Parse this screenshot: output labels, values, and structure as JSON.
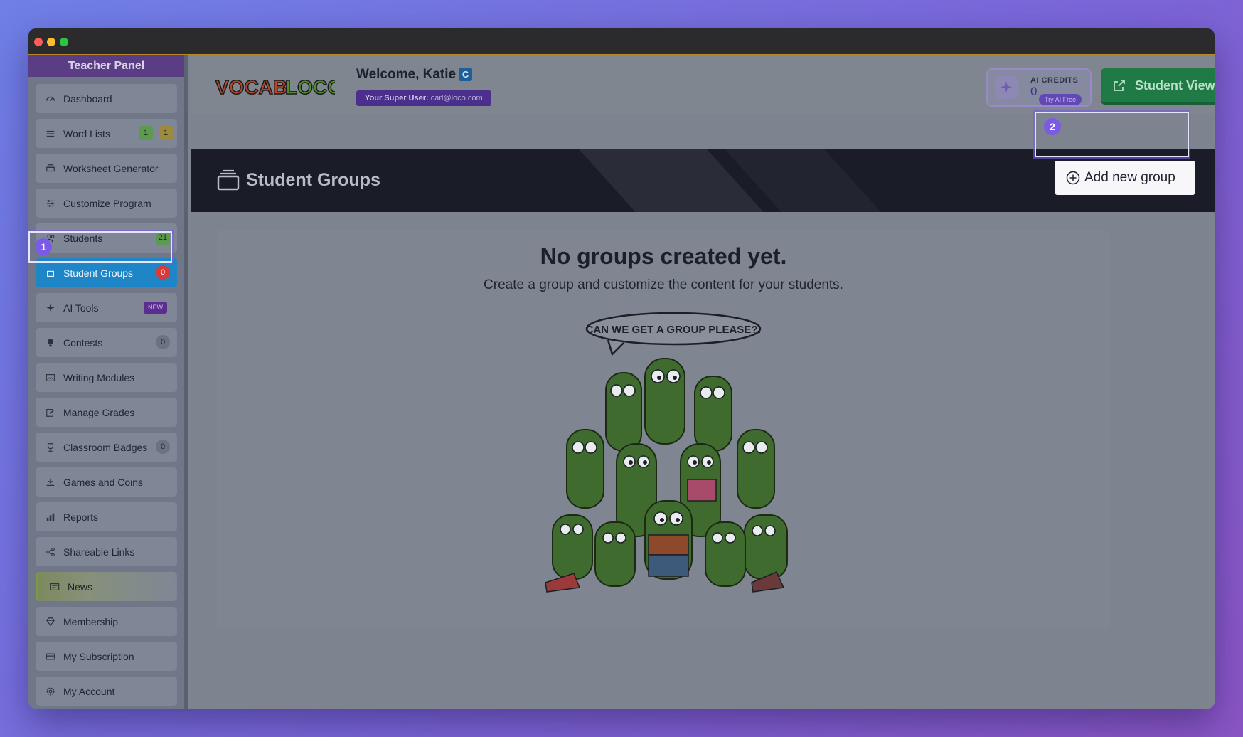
{
  "sidebar": {
    "title": "Teacher Panel",
    "items": [
      {
        "label": "Dashboard",
        "icon": "dashboard-icon"
      },
      {
        "label": "Word Lists",
        "icon": "list-icon",
        "badges": [
          "1",
          "1"
        ]
      },
      {
        "label": "Worksheet Generator",
        "icon": "printer-icon"
      },
      {
        "label": "Customize Program",
        "icon": "sliders-icon"
      },
      {
        "label": "Students",
        "icon": "users-icon",
        "badges": [
          "21"
        ]
      },
      {
        "label": "Student Groups",
        "icon": "layers-icon",
        "badges": [
          "0"
        ],
        "active": true
      },
      {
        "label": "AI Tools",
        "icon": "sparkle-icon",
        "badges": [
          "NEW"
        ]
      },
      {
        "label": "Contests",
        "icon": "lightbulb-icon",
        "badges": [
          "0"
        ]
      },
      {
        "label": "Writing Modules",
        "icon": "image-icon"
      },
      {
        "label": "Manage Grades",
        "icon": "edit-icon"
      },
      {
        "label": "Classroom Badges",
        "icon": "trophy-icon",
        "badges": [
          "0"
        ]
      },
      {
        "label": "Games and Coins",
        "icon": "coins-icon"
      },
      {
        "label": "Reports",
        "icon": "bar-chart-icon"
      },
      {
        "label": "Shareable Links",
        "icon": "share-icon"
      },
      {
        "label": "News",
        "icon": "newspaper-icon"
      },
      {
        "label": "Membership",
        "icon": "diamond-icon"
      },
      {
        "label": "My Subscription",
        "icon": "credit-card-icon"
      },
      {
        "label": "My Account",
        "icon": "gear-icon"
      }
    ]
  },
  "header": {
    "logo_text": "VOCAB LOCO",
    "welcome": "Welcome, Katie",
    "welcome_badge": "C",
    "super_user_label": "Your Super User:",
    "super_user_email": "carl@loco.com",
    "ai_credits_label": "AI CREDITS",
    "ai_credits_value": "0",
    "try_ai_free": "Try AI Free",
    "student_view": "Student View"
  },
  "banner": {
    "title": "Student Groups",
    "add_button": "Add new group"
  },
  "empty_state": {
    "heading": "No groups created yet.",
    "subtext": "Create a group and customize the content for your students.",
    "speech_bubble": "CAN WE GET A GROUP PLEASE?!"
  },
  "steps": {
    "one": "1",
    "two": "2"
  },
  "colors": {
    "active_nav": "#1e86c7",
    "accent_purple": "#5b3d85",
    "student_view_green": "#1f7a46",
    "badge_red": "#d63b3b"
  }
}
